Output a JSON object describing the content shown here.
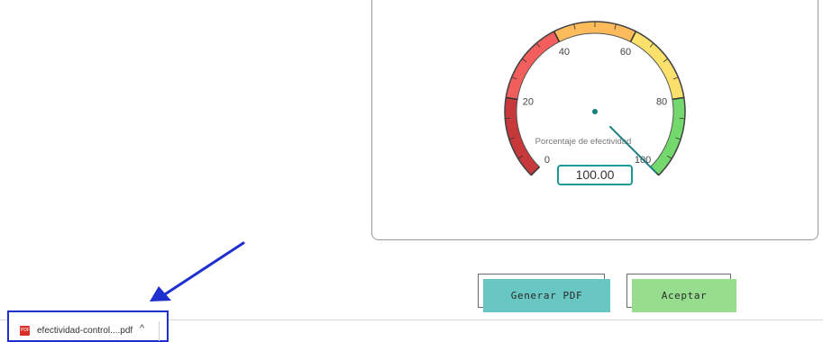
{
  "gauge": {
    "ticks": [
      "0",
      "20",
      "40",
      "60",
      "80",
      "100"
    ],
    "label": "Porcentaje de efectividad",
    "value_text": "100.00",
    "value": 100,
    "bands": [
      {
        "color": "#c7383a"
      },
      {
        "color": "#f25e5b"
      },
      {
        "color": "#fdbb5c"
      },
      {
        "color": "#fbe06b"
      },
      {
        "color": "#74d96c"
      }
    ],
    "needle_color": "#177e80"
  },
  "buttons": {
    "generate_pdf": {
      "label": "Generar PDF",
      "color": "#68c6c3"
    },
    "accept": {
      "label": "Aceptar",
      "color": "#96dd8d"
    }
  },
  "download": {
    "file_name": "efectividad-control....pdf",
    "icon": "pdf-file-icon",
    "icon_text": "PDF",
    "chevron": "^"
  },
  "annotation": {
    "arrow_color": "#1e2fd0"
  }
}
